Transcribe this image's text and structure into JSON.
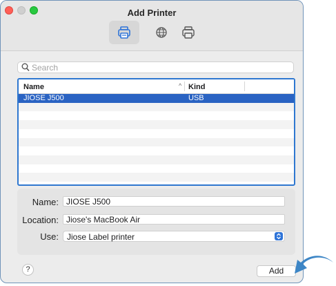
{
  "window": {
    "title": "Add Printer"
  },
  "toolbar": {
    "tabs": [
      {
        "icon": "default-printer-icon",
        "active": true
      },
      {
        "icon": "ip-globe-icon",
        "active": false
      },
      {
        "icon": "windows-printer-icon",
        "active": false
      }
    ]
  },
  "search": {
    "placeholder": "Search",
    "value": ""
  },
  "table": {
    "columns": [
      "Name",
      "Kind"
    ],
    "sort_indicator": "^",
    "rows": [
      {
        "name": "JIOSE J500",
        "kind": "USB",
        "selected": true
      }
    ]
  },
  "details": {
    "name_label": "Name:",
    "name_value": "JIOSE J500",
    "location_label": "Location:",
    "location_value": "Jiose's MacBook Air",
    "use_label": "Use:",
    "use_value": "Jiose Label printer"
  },
  "footer": {
    "help_label": "?",
    "add_label": "Add"
  },
  "colors": {
    "accent": "#2a63c3",
    "table_border": "#2e77d0",
    "close": "#ff5f57",
    "maximize": "#28c840",
    "arrow": "#3d86c6"
  }
}
